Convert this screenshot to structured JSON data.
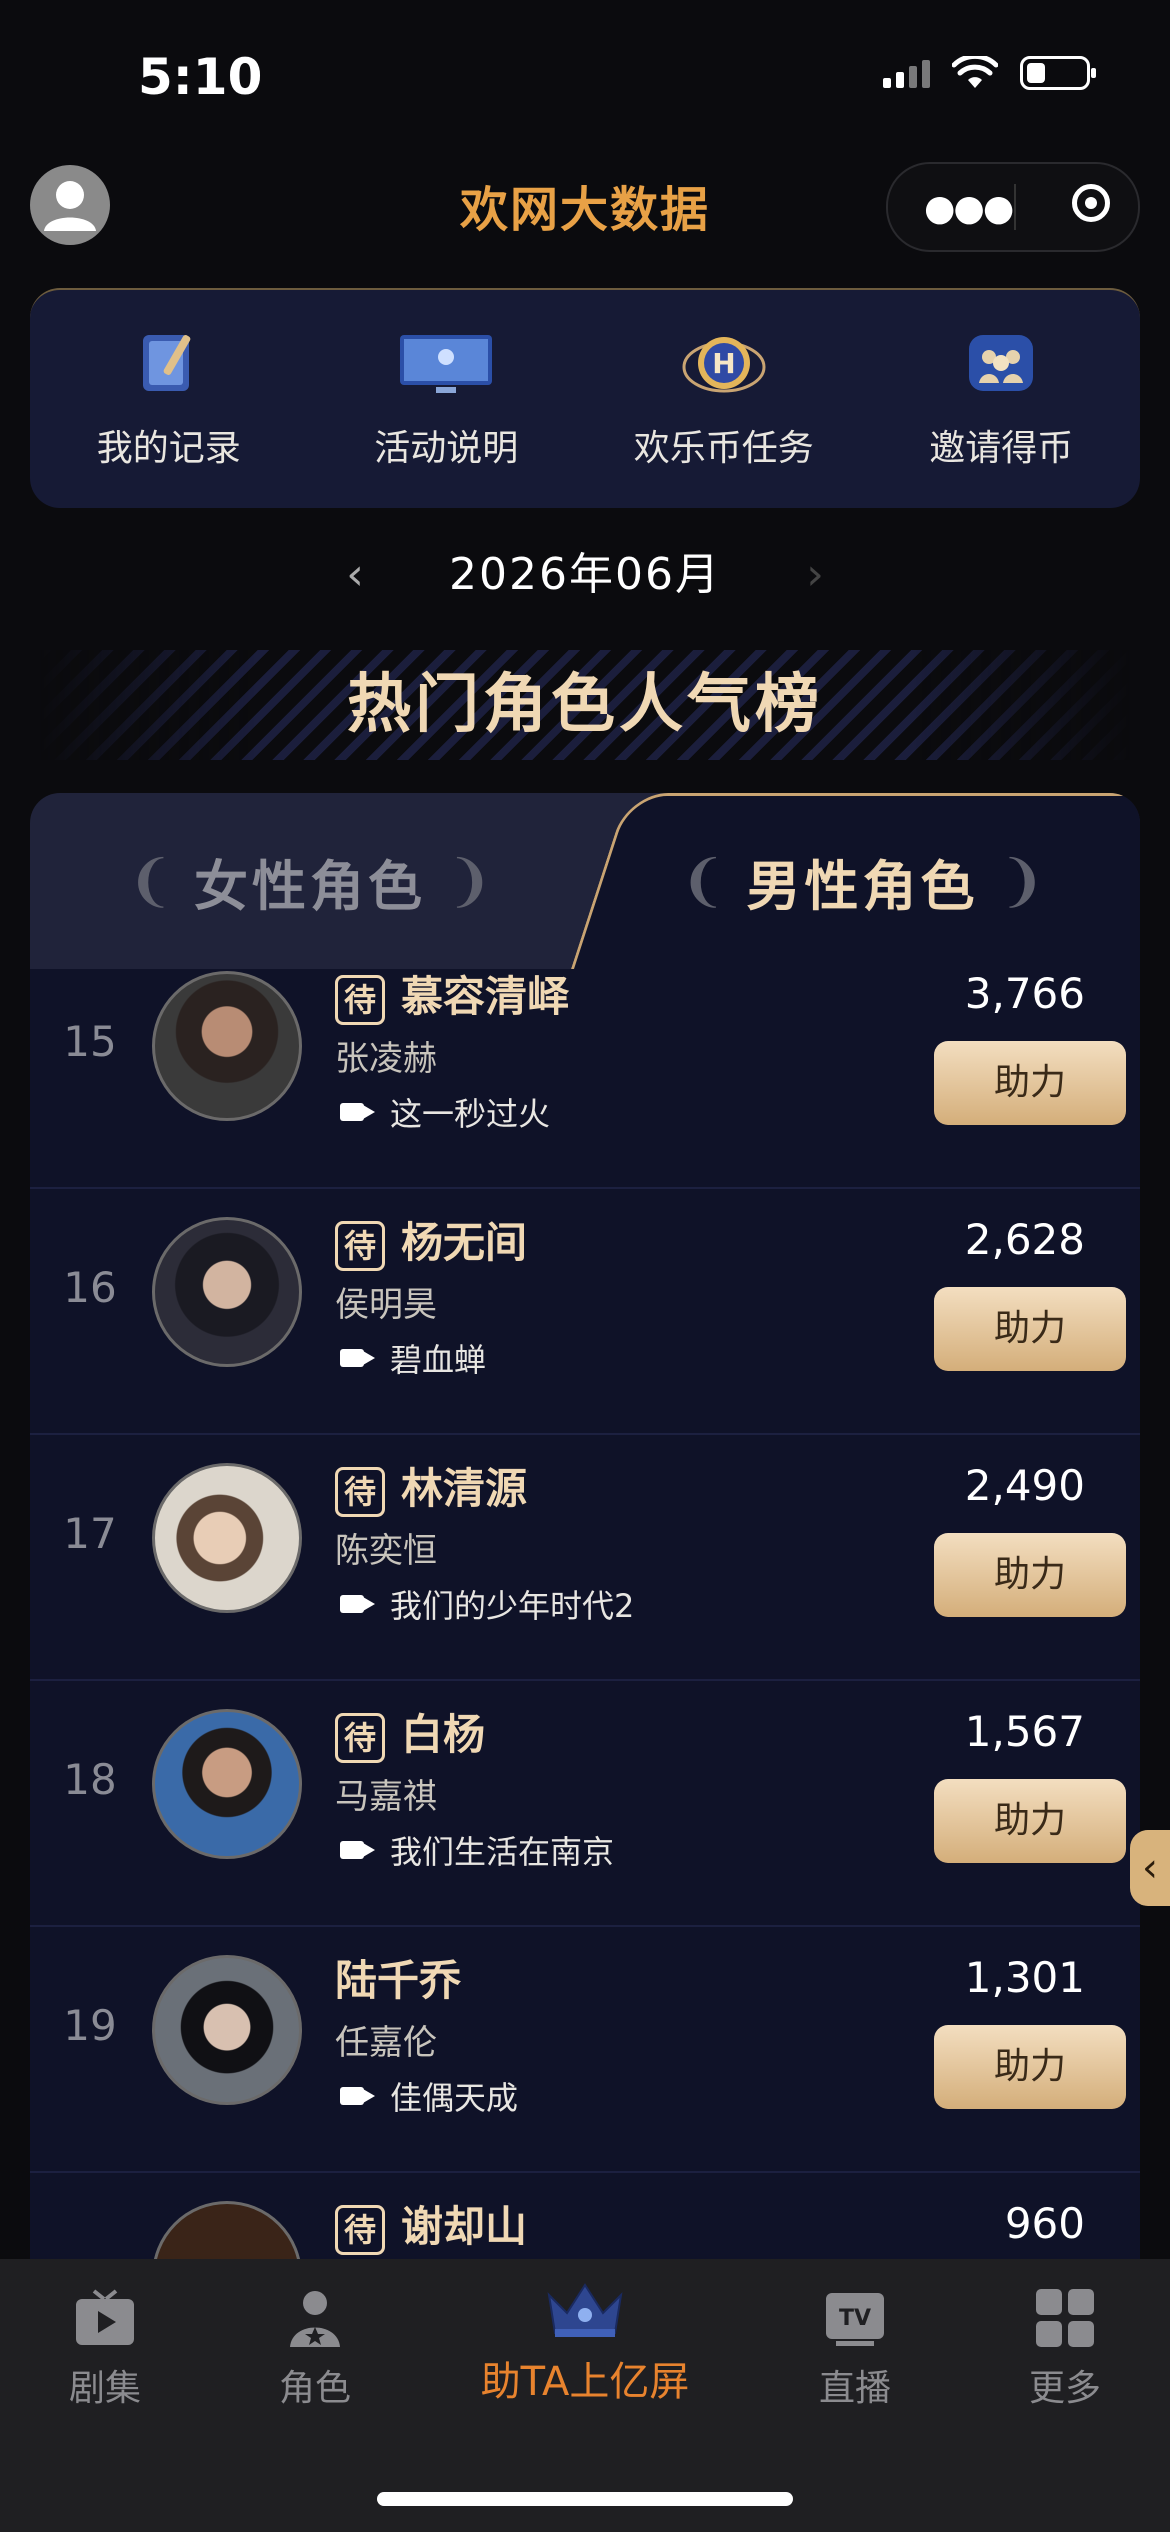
{
  "status_bar": {
    "time": "5:10"
  },
  "header": {
    "logo": "欢网大数据"
  },
  "menu": [
    {
      "label": "我的记录",
      "icon": "notebook-icon"
    },
    {
      "label": "活动说明",
      "icon": "tv-screen-icon"
    },
    {
      "label": "欢乐币任务",
      "icon": "coin-h-icon"
    },
    {
      "label": "邀请得币",
      "icon": "people-group-icon"
    }
  ],
  "month": "2026年06月",
  "banner_title": "热门角色人气榜",
  "tabs": {
    "female": "女性角色",
    "male": "男性角色"
  },
  "rows": [
    {
      "rank": "15",
      "badge": "待",
      "name": "慕容清峄",
      "actor": "张凌赫",
      "show": "这一秒过火",
      "votes": "3,766",
      "button": "助力"
    },
    {
      "rank": "16",
      "badge": "待",
      "name": "杨无间",
      "actor": "侯明昊",
      "show": "碧血蝉",
      "votes": "2,628",
      "button": "助力"
    },
    {
      "rank": "17",
      "badge": "待",
      "name": "林清源",
      "actor": "陈奕恒",
      "show": "我们的少年时代2",
      "votes": "2,490",
      "button": "助力"
    },
    {
      "rank": "18",
      "badge": "待",
      "name": "白杨",
      "actor": "马嘉祺",
      "show": "我们生活在南京",
      "votes": "1,567",
      "button": "助力"
    },
    {
      "rank": "19",
      "badge": "",
      "name": "陆千乔",
      "actor": "任嘉伦",
      "show": "佳偶天成",
      "votes": "1,301",
      "button": "助力"
    },
    {
      "rank": "",
      "badge": "待",
      "name": "谢却山",
      "actor": "",
      "show": "",
      "votes": "960",
      "button": ""
    }
  ],
  "side_tab": "‹",
  "tabbar": {
    "items": [
      {
        "label": "剧集"
      },
      {
        "label": "角色"
      },
      {
        "label": "助TA上亿屏"
      },
      {
        "label": "直播"
      },
      {
        "label": "更多"
      }
    ]
  }
}
